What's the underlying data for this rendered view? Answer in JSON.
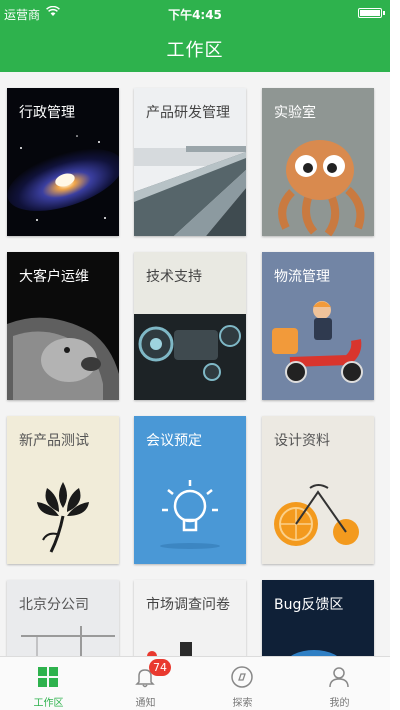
{
  "status_bar": {
    "carrier": "运营商",
    "time": "下午4:45"
  },
  "header": {
    "title": "工作区"
  },
  "tiles": [
    {
      "label": "行政管理"
    },
    {
      "label": "产品研发管理"
    },
    {
      "label": "实验室"
    },
    {
      "label": "大客户运维"
    },
    {
      "label": "技术支持"
    },
    {
      "label": "物流管理"
    },
    {
      "label": "新产品测试"
    },
    {
      "label": "会议预定"
    },
    {
      "label": "设计资料"
    },
    {
      "label": "北京分公司"
    },
    {
      "label": "市场调查问卷"
    },
    {
      "label": "Bug反馈区"
    }
  ],
  "tabbar": {
    "active": "工作区",
    "items": [
      {
        "label": "工作区",
        "icon": "grid-icon"
      },
      {
        "label": "通知",
        "icon": "bell-icon",
        "badge": "74"
      },
      {
        "label": "探索",
        "icon": "compass-icon"
      },
      {
        "label": "我的",
        "icon": "user-icon"
      }
    ]
  },
  "colors": {
    "brand_green": "#2eb24d",
    "badge_red": "#e9392f"
  }
}
